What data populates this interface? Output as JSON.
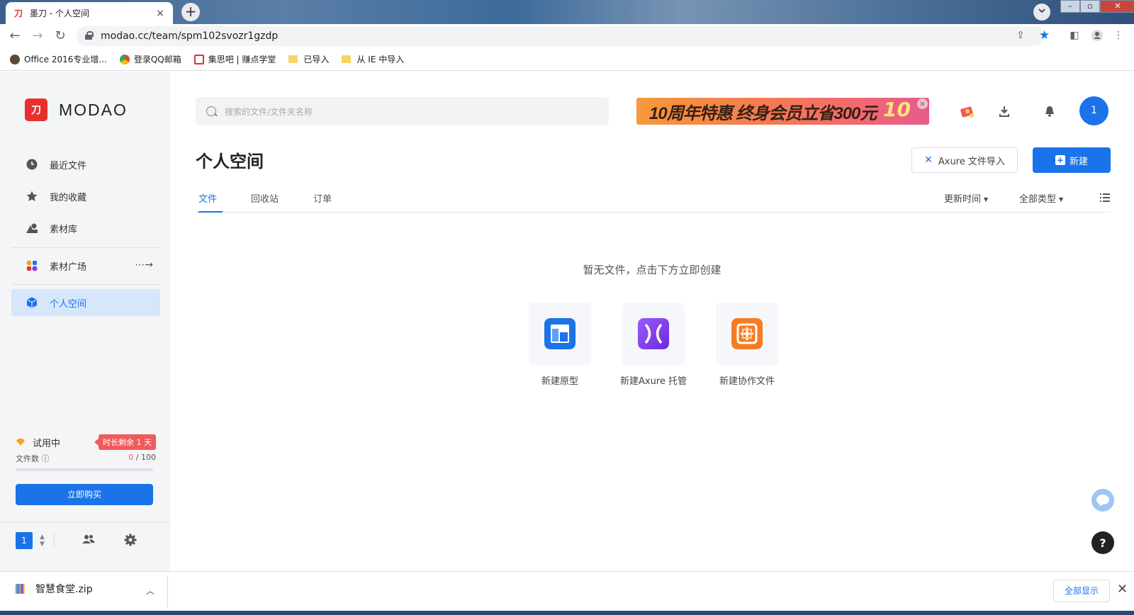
{
  "browser": {
    "tab_title": "墨刀 - 个人空间",
    "tab_favicon": "刀",
    "tab_close": "×",
    "new_tab": "+",
    "url": "modao.cc/team/spm102svozr1gzdp",
    "bookmarks": [
      {
        "label": "Office 2016专业增...",
        "icon": "avatar-icon"
      },
      {
        "label": "登录QQ邮箱",
        "icon": "chrome-icon"
      },
      {
        "label": "集思吧 | 赚点学堂",
        "icon": "image-icon"
      },
      {
        "label": "已导入",
        "icon": "folder-icon"
      },
      {
        "label": "从 IE 中导入",
        "icon": "folder-icon"
      }
    ]
  },
  "sidebar": {
    "logo_text": "MODAO",
    "logo_mark": "刀",
    "items": [
      {
        "label": "最近文件",
        "icon": "clock-icon"
      },
      {
        "label": "我的收藏",
        "icon": "star-icon"
      },
      {
        "label": "素材库",
        "icon": "assets-icon"
      },
      {
        "label": "素材广场",
        "icon": "shapes-icon",
        "arrow": "⋯→"
      },
      {
        "label": "个人空间",
        "icon": "cube-icon",
        "active": true
      }
    ],
    "trial": {
      "label": "试用中",
      "badge": "时长剩余 1 天",
      "files_label": "文件数 ⓘ",
      "files_used": "0",
      "files_total": "/ 100",
      "progress": 0
    },
    "buy_button": "立即购买",
    "team_number": "1",
    "team_sort": "▲▼"
  },
  "header": {
    "search_placeholder": "搜索的文件/文件夹名称",
    "banner_text": "10周年特惠 终身会员立省300元",
    "banner_badge": "10",
    "banner_close": "×",
    "avatar": "1"
  },
  "main": {
    "title": "个人空间",
    "axure_import": "Axure 文件导入",
    "axure_x": "✕",
    "new_button": "新建",
    "new_plus": "+",
    "tabs": [
      {
        "label": "文件",
        "active": true
      },
      {
        "label": "回收站"
      },
      {
        "label": "订单"
      }
    ],
    "sort_time": "更新时间",
    "sort_type": "全部类型",
    "caret": "▼",
    "empty_message": "暂无文件，点击下方立即创建",
    "create_options": [
      {
        "label": "新建原型",
        "icon": "prototype-icon",
        "color": "#1a73e8"
      },
      {
        "label": "新建Axure 托管",
        "icon": "axure-icon",
        "color": "#7b3fe4"
      },
      {
        "label": "新建协作文件",
        "icon": "collab-icon",
        "color": "#f57c22"
      }
    ],
    "help": "?"
  },
  "download_bar": {
    "filename": "智慧食堂.zip",
    "chevron": "︿",
    "show_all": "全部显示",
    "close": "✕"
  },
  "colors": {
    "accent": "#1a73e8",
    "brand_red": "#e8302f",
    "badge_red": "#f15a5a"
  }
}
